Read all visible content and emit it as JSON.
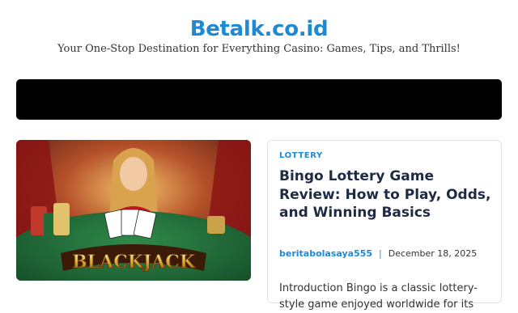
{
  "site": {
    "title": "Betalk.co.id",
    "tagline": "Your One-Stop Destination for Everything Casino: Games, Tips, and Thrills!"
  },
  "featured_image": {
    "text": "BLACKJACK"
  },
  "post": {
    "category": "LOTTERY",
    "title": "Bingo Lottery Game Review: How to Play, Odds, and Winning Basics",
    "author": "beritabolasaya555",
    "separator": "|",
    "date": "December 18, 2025",
    "excerpt": "Introduction Bingo is a classic lottery-style game enjoyed worldwide for its"
  },
  "colors": {
    "accent": "#1e8ad6",
    "nav_background": "#000000",
    "title_text": "#1f2a44"
  }
}
